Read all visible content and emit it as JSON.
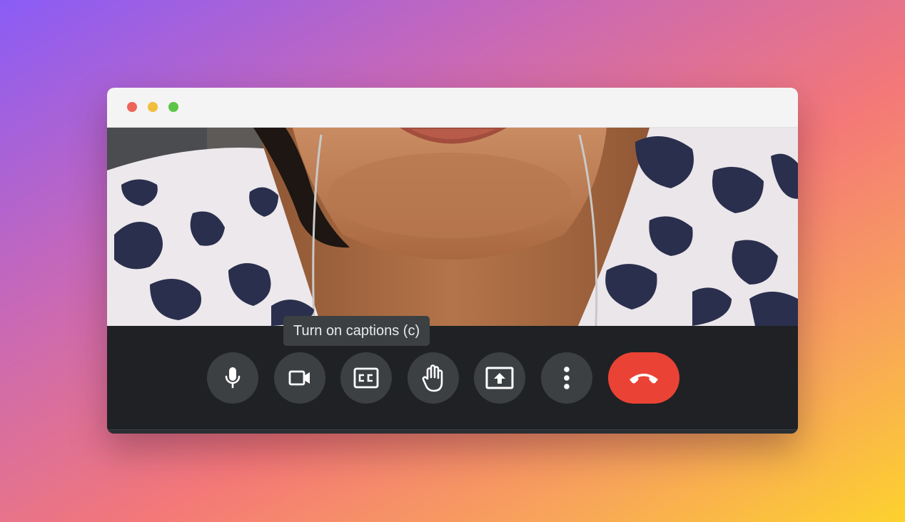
{
  "window": {
    "traffic_lights": [
      "close",
      "minimize",
      "zoom"
    ]
  },
  "tooltip": {
    "text": "Turn on captions (c)"
  },
  "controls": {
    "mic": {
      "icon": "microphone-icon"
    },
    "camera": {
      "icon": "video-camera-icon"
    },
    "captions": {
      "icon": "closed-captions-icon",
      "label": "CC"
    },
    "raise_hand": {
      "icon": "hand-icon"
    },
    "present": {
      "icon": "present-screen-icon"
    },
    "more": {
      "icon": "more-vertical-icon"
    },
    "end_call": {
      "icon": "end-call-icon"
    }
  },
  "colors": {
    "control_bar": "#202124",
    "button": "#3c4043",
    "end_call": "#ea4335",
    "icon": "#ffffff"
  }
}
